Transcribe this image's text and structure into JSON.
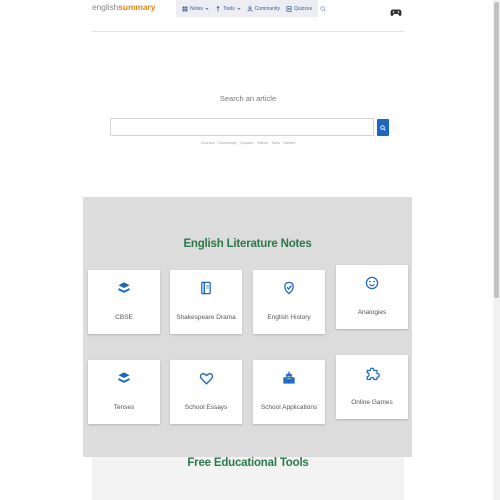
{
  "header": {
    "logo_part1": "english",
    "logo_part2": "summary",
    "nav": [
      {
        "label": "Notes",
        "icon": "notes-icon",
        "dropdown": true
      },
      {
        "label": "Tools",
        "icon": "tools-icon",
        "dropdown": true
      },
      {
        "label": "Community",
        "icon": "community-icon",
        "dropdown": false
      },
      {
        "label": "Quizzes",
        "icon": "quizzes-icon",
        "dropdown": false
      }
    ],
    "gamepad_icon": "gamepad-icon"
  },
  "search": {
    "label": "Search an article",
    "placeholder": "",
    "value": "",
    "hints": "Courses · Community · Quizzes · Videos · Tools · Games"
  },
  "notes": {
    "title": "English Literature Notes",
    "cards": [
      {
        "label": "CBSE",
        "icon": "cbse-icon"
      },
      {
        "label": "Shakespeare Drama",
        "icon": "book-icon"
      },
      {
        "label": "English History",
        "icon": "history-icon"
      },
      {
        "label": "Analogies",
        "icon": "smile-icon"
      },
      {
        "label": "Tenses",
        "icon": "tenses-icon"
      },
      {
        "label": "School Essays",
        "icon": "heart-icon"
      },
      {
        "label": "School Applications",
        "icon": "building-icon"
      },
      {
        "label": "Online Games",
        "icon": "puzzle-icon"
      }
    ]
  },
  "tools": {
    "title": "Free Educational Tools"
  },
  "colors": {
    "brand_orange": "#e28a1c",
    "heading_green": "#2b7a47",
    "icon_blue": "#1c67c0",
    "nav_text": "#3d5f93",
    "panel_gray": "#dcdcdc"
  }
}
